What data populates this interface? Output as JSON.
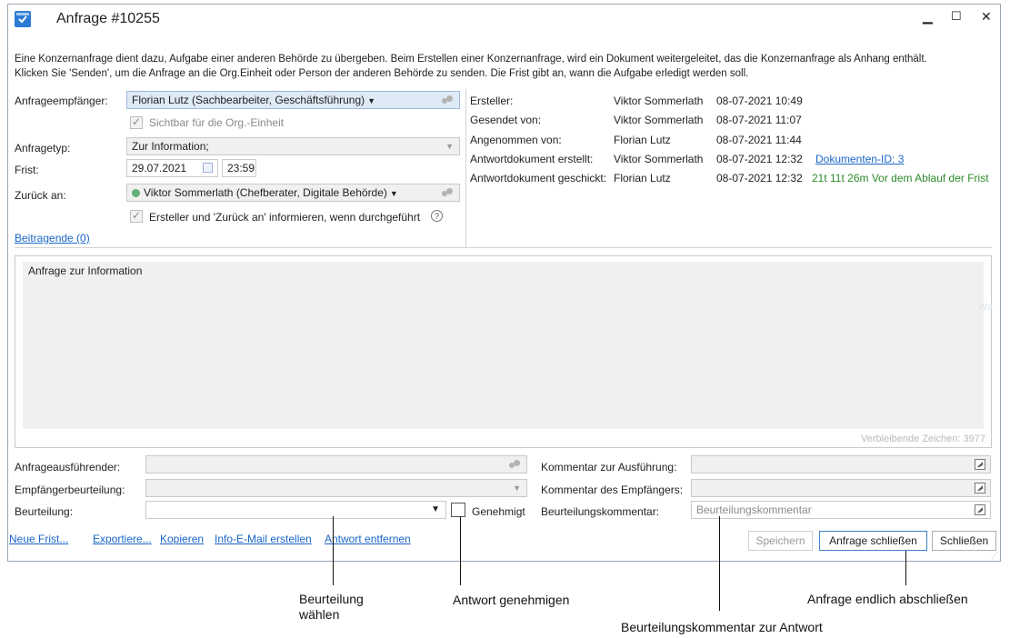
{
  "window": {
    "title": "Anfrage #10255",
    "controls": {
      "minimize": "▁",
      "maximize": "☐",
      "close": "✕"
    }
  },
  "description": {
    "line1": "Eine Konzernanfrage dient dazu, Aufgabe einer anderen Behörde zu übergeben. Beim Erstellen einer Konzernanfrage, wird ein Dokument weitergeleitet, das die Konzernanfrage als Anhang enthält.",
    "line2": "Klicken Sie 'Senden', um die Anfrage an die Org.Einheit oder Person der anderen Behörde zu senden. Die Frist gibt an, wann die Aufgabe erledigt werden soll."
  },
  "form": {
    "recipient_label": "Anfrageempfänger:",
    "recipient_value": "Florian Lutz (Sachbearbeiter, Geschäftsführung)",
    "visible_label": "Sichtbar für die Org.-Einheit",
    "type_label": "Anfragetyp:",
    "type_value": "Zur Information;",
    "deadline_label": "Frist:",
    "deadline_date": "29.07.2021",
    "deadline_time": "23:59",
    "return_label": "Zurück an:",
    "return_value": "Viktor Sommerlath (Chefberater, Digitale Behörde)",
    "notify_label": "Ersteller und 'Zurück an' informieren, wenn durchgeführt",
    "contributors_link": "Beitragende (0)"
  },
  "info": {
    "rows": [
      {
        "label": "Ersteller:",
        "person": "Viktor Sommerlath",
        "date": "08-07-2021 10:49"
      },
      {
        "label": "Gesendet von:",
        "person": "Viktor Sommerlath",
        "date": "08-07-2021 11:07"
      },
      {
        "label": "Angenommen von:",
        "person": "Florian Lutz",
        "date": "08-07-2021 11:44"
      },
      {
        "label": "Antwortdokument erstellt:",
        "person": "Viktor Sommerlath",
        "date": "08-07-2021 12:32",
        "extra": "Dokumenten-ID: 3"
      },
      {
        "label": "Antwortdokument geschickt:",
        "person": "Florian Lutz",
        "date": "08-07-2021 12:32",
        "extra": "21t 11t 26m Vor dem Ablauf der Frist"
      }
    ]
  },
  "request_text": {
    "content": "Anfrage zur Information",
    "remaining": "Verbleibende Zeichen: 3977",
    "ghost": "We"
  },
  "bottom": {
    "executor_label": "Anfrageausführender:",
    "recipient_eval_label": "Empfängerbeurteilung:",
    "evaluation_label": "Beurteilung:",
    "approved_label": "Genehmigt",
    "exec_comment_label": "Kommentar zur Ausführung:",
    "recipient_comment_label": "Kommentar des Empfängers:",
    "eval_comment_label": "Beurteilungskommentar:",
    "eval_comment_value": "Beurteilungskommentar"
  },
  "links": [
    "Neue Frist...",
    "Exportiere...",
    "Kopieren",
    "Info-E-Mail erstellen",
    "Antwort entfernen"
  ],
  "buttons": {
    "save": "Speichern",
    "close_request": "Anfrage schließen",
    "close": "Schließen"
  },
  "callouts": {
    "evaluation": "Beurteilung\nwählen",
    "approve": "Antwort genehmigen",
    "finish": "Anfrage endlich abschließen",
    "comment": "Beurteilungskommentar zur Antwort"
  },
  "colors": {
    "accent": "#2b7bd6",
    "link": "#1a66c7",
    "success": "#2c8a2c"
  }
}
